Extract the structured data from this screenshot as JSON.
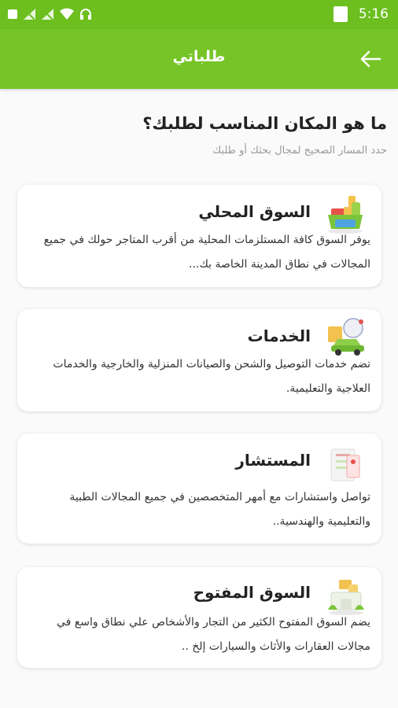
{
  "status_bar": {
    "time": "5:16"
  },
  "app_bar": {
    "title": "طلباتي"
  },
  "intro": {
    "heading": "ما هو المكان المناسب لطلبك؟",
    "subheading": "حدد المسار الصحيح لمجال بحثك أو طلبك"
  },
  "options": [
    {
      "title": "السوق المحلي",
      "icon": "grocery-basket-icon",
      "description": "يوفر السوق كافة المستلزمات المحلية من أقرب المتاجر حولك في جميع المجالات في نطاق المدينة الخاصة بك..."
    },
    {
      "title": "الخدمات",
      "icon": "delivery-car-icon",
      "description": "تضم خدمات التوصيل والشحن والصيانات المنزلية والخارجية والخدمات العلاجية والتعليمية."
    },
    {
      "title": "المستشار",
      "icon": "consultant-document-icon",
      "description": "تواصل واستشارات مع أمهر المتخصصين في جميع المجالات الطبية والتعليمية والهندسية.."
    },
    {
      "title": "السوق المفتوح",
      "icon": "open-market-icon",
      "description": "يضم السوق المفتوح الكثير من التجار والأشخاص علي نطاق واسع في مجالات العقارات والأثاث والسيارات إلخ .."
    }
  ],
  "colors": {
    "primary": "#76c427",
    "status_bar": "#6cbf1f"
  }
}
